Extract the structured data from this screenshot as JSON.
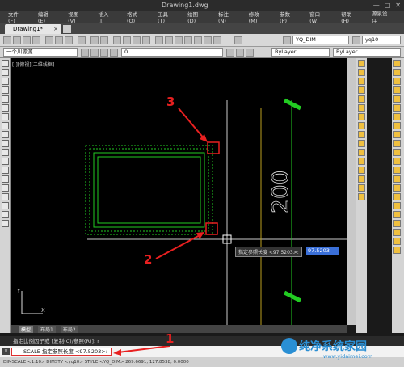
{
  "window": {
    "title": "Drawing1.dwg"
  },
  "menu": [
    "文件(F)",
    "编辑(E)",
    "视图(V)",
    "插入(I)",
    "格式(O)",
    "工具(T)",
    "绘图(D)",
    "标注(N)",
    "修改(M)",
    "参数(P)",
    "窗口(W)",
    "帮助(H)",
    "源泉设计"
  ],
  "tabs": {
    "doc": "Drawing1*"
  },
  "toolbar": {
    "dimstyle": "YQ_DIM",
    "textstyle": "yq10"
  },
  "toolbar2": {
    "layer": "0",
    "color": "ByLayer",
    "linetype": "ByLayer",
    "layer_state": "一个川源源"
  },
  "canvas": {
    "view_label": "[-][俯视][二维线框]",
    "dim_text": "200"
  },
  "tooltip": {
    "prompt": "指定参照长度 <97.5203>:",
    "value": "97.5203"
  },
  "annotations": [
    "1",
    "2",
    "3"
  ],
  "layout_tabs": [
    "模型",
    "布局1",
    "布局2"
  ],
  "command": {
    "history": "指定比例因子或 [复制(C)/参照(R)]: r",
    "input": "SCALE 指定参照长度 <97.5203>:"
  },
  "status": {
    "text": "DIMSCALE <1:10> DIMSTY <yq10> STYLE <YQ_DIM>  269.6691, 127.8538, 0.0000"
  },
  "watermark": {
    "main": "纯净系统家园",
    "sub": "www.yidaimei.com"
  },
  "colors": {
    "canvas": "#000000",
    "green": "#22cc22",
    "red": "#e82020",
    "highlight": "#3a6fd8"
  }
}
